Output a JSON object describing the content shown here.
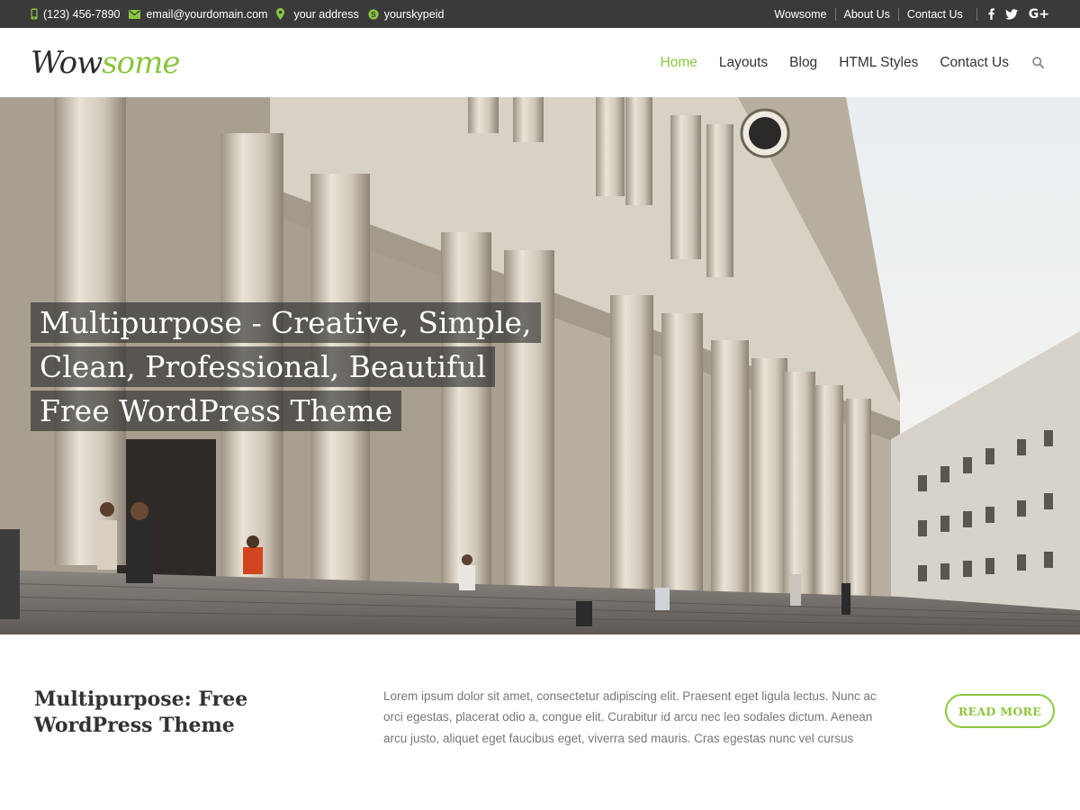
{
  "topbar": {
    "phone": "(123) 456-7890",
    "email": "email@yourdomain.com",
    "address": "your address",
    "skype": "yourskypeid",
    "links": [
      "Wowsome",
      "About Us",
      "Contact Us"
    ],
    "social": [
      "facebook-icon",
      "twitter-icon",
      "google-plus-icon"
    ],
    "google_plus_text": "G+"
  },
  "header": {
    "logo_part1": "Wow",
    "logo_part2": "some",
    "nav": [
      "Home",
      "Layouts",
      "Blog",
      "HTML Styles",
      "Contact Us"
    ],
    "active_nav": "Home"
  },
  "hero": {
    "title_lines": [
      "Multipurpose - Creative, Simple,",
      "Clean, Professional, Beautiful",
      "Free WordPress Theme"
    ]
  },
  "intro": {
    "heading": "Multipurpose: Free WordPress Theme",
    "body": "Lorem ipsum dolor sit amet, consectetur adipiscing elit. Praesent eget ligula lectus. Nunc ac orci egestas, placerat odio a, congue elit. Curabitur id arcu nec leo sodales dictum. Aenean arcu justo, aliquet eget faucibus eget, viverra sed mauris. Cras egestas nunc vel cursus",
    "button_label": "READ MORE"
  },
  "colors": {
    "accent": "#8cc63f",
    "topbar_bg": "#3a3a3a",
    "text": "#333333",
    "muted_text": "#777777"
  }
}
